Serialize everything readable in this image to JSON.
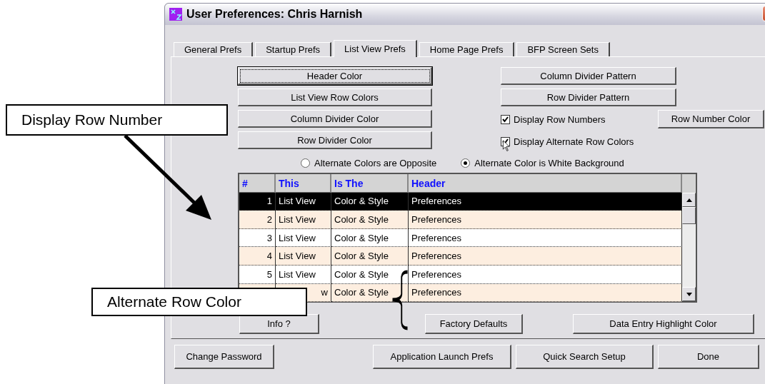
{
  "window": {
    "title": "User Preferences: Chris Harnish"
  },
  "tabs": [
    {
      "label": "General Prefs",
      "selected": false
    },
    {
      "label": "Startup Prefs",
      "selected": false
    },
    {
      "label": "List View Prefs",
      "selected": true
    },
    {
      "label": "Home Page Prefs",
      "selected": false
    },
    {
      "label": "BFP Screen Sets",
      "selected": false
    }
  ],
  "left_buttons": [
    {
      "label": "Header Color",
      "focused": true
    },
    {
      "label": "List View Row Colors",
      "focused": false
    },
    {
      "label": "Column Divider Color",
      "focused": false
    },
    {
      "label": "Row Divider Color",
      "focused": false
    }
  ],
  "right_buttons": [
    "Column Divider Pattern",
    "Row Divider Pattern"
  ],
  "checkboxes": [
    {
      "label": "Display Row Numbers",
      "checked": true
    },
    {
      "label": "Display Alternate Row Colors",
      "checked": true
    }
  ],
  "row_number_color_button": "Row Number Color",
  "radios": [
    {
      "label": "Alternate Colors are Opposite",
      "selected": false
    },
    {
      "label": "Alternate Color is White Background",
      "selected": true
    }
  ],
  "table": {
    "columns": [
      "#",
      "This",
      "Is The",
      "Header"
    ],
    "rows": [
      {
        "number": "1",
        "this": "List View",
        "is_the": "Color & Style",
        "header": "Preferences",
        "selected": true
      },
      {
        "number": "2",
        "this": "List View",
        "is_the": "Color & Style",
        "header": "Preferences",
        "selected": false
      },
      {
        "number": "3",
        "this": "List View",
        "is_the": "Color & Style",
        "header": "Preferences",
        "selected": false
      },
      {
        "number": "4",
        "this": "List View",
        "is_the": "Color & Style",
        "header": "Preferences",
        "selected": false
      },
      {
        "number": "5",
        "this": "List View",
        "is_the": "Color & Style",
        "header": "Preferences",
        "selected": false
      },
      {
        "this": "w",
        "is_the": "Color & Style",
        "header": "Preferences",
        "selected": false
      }
    ]
  },
  "panel_buttons": [
    "Info ?",
    "Factory Defaults",
    "Data Entry Highlight Color"
  ],
  "footer_buttons": [
    "Change Password",
    "Application Launch Prefs",
    "Quick Search Setup",
    "Done"
  ],
  "annotations": [
    {
      "text": "Display Row Number"
    },
    {
      "text": "Alternate Row Color"
    }
  ]
}
